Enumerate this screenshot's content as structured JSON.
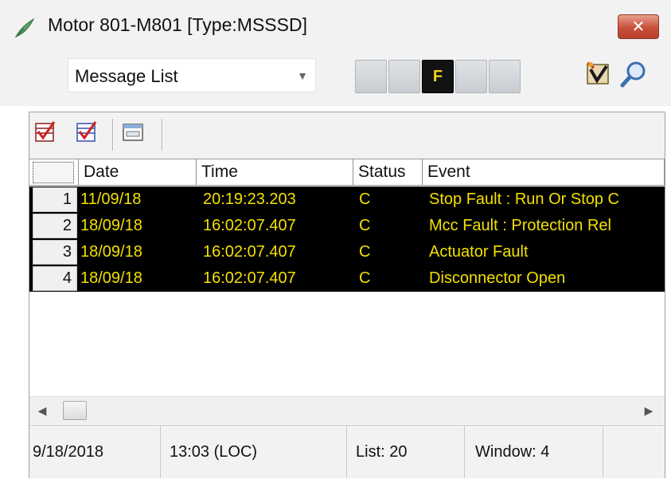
{
  "window": {
    "title": "Motor 801-M801  [Type:MSSSD]",
    "close_label": "✕"
  },
  "toolbar": {
    "view_select": {
      "value": "Message List"
    },
    "indicators": [
      {
        "label": "",
        "active": false
      },
      {
        "label": "",
        "active": false
      },
      {
        "label": "F",
        "active": true
      },
      {
        "label": "",
        "active": false
      },
      {
        "label": "",
        "active": false
      }
    ],
    "icons": [
      "alarm-acknowledge-icon",
      "search-icon"
    ]
  },
  "panel_tools": {
    "icons": [
      "checklist-icon",
      "checklist-red-icon",
      "window-icon"
    ]
  },
  "grid": {
    "columns": [
      "Date",
      "Time",
      "Status",
      "Event"
    ],
    "rows": [
      {
        "num": "1",
        "date": "11/09/18",
        "time": "20:19:23.203",
        "status": "C",
        "event": "Stop Fault : Run Or Stop C"
      },
      {
        "num": "2",
        "date": "18/09/18",
        "time": "16:02:07.407",
        "status": "C",
        "event": "Mcc Fault : Protection Rel"
      },
      {
        "num": "3",
        "date": "18/09/18",
        "time": "16:02:07.407",
        "status": "C",
        "event": "Actuator Fault"
      },
      {
        "num": "4",
        "date": "18/09/18",
        "time": "16:02:07.407",
        "status": "C",
        "event": "Disconnector Open"
      }
    ]
  },
  "statusbar": {
    "date": "9/18/2018",
    "time": "13:03 (LOC)",
    "list": "List: 20",
    "window": "Window: 4"
  },
  "colors": {
    "row_background": "#000000",
    "row_text": "#f2e000",
    "active_indicator": "#121212"
  }
}
